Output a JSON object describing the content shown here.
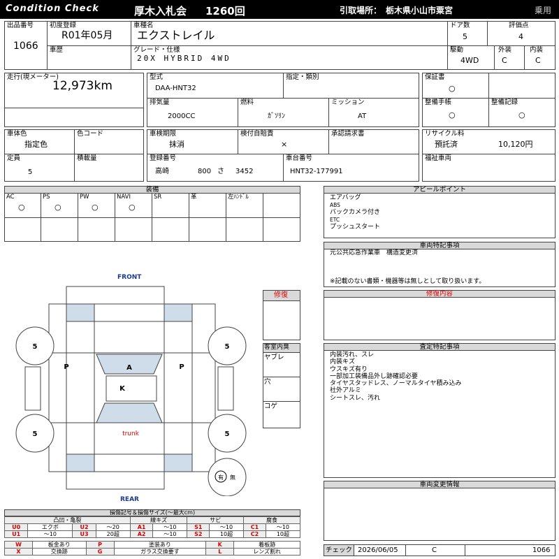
{
  "header": {
    "brand": "Condition Check",
    "auction": "厚木入札会",
    "session": "1260回",
    "pickup_label": "引取場所：",
    "pickup_place": "栃木県小山市粟宮",
    "category": "乗用"
  },
  "vehicle": {
    "lot_label": "出品番号",
    "lot": "1066",
    "first_reg_label": "初度登録",
    "first_reg": "R01年05月",
    "name_label": "車種名",
    "name": "エクストレイル",
    "doors_label": "ドア数",
    "doors": "5",
    "grade_score_label": "評価点",
    "grade_score": "4",
    "history_label": "車歴",
    "grade_label": "グレード・仕様",
    "grade": "20X HYBRID 4WD",
    "drive_label": "駆動",
    "drive": "4WD",
    "exterior_label": "外装",
    "exterior": "C",
    "interior_label": "内装",
    "interior": "C",
    "mileage_label": "走行(現メーター)",
    "mileage": "12,973km",
    "model_label": "型式",
    "model": "DAA-HNT32",
    "designation_label": "指定・類別",
    "warranty_label": "保証書",
    "warranty": "○",
    "displacement_label": "排気量",
    "displacement": "2000CC",
    "fuel_label": "燃料",
    "fuel": "ｶﾞｿﾘﾝ",
    "mission_label": "ミッション",
    "mission": "AT",
    "service_book_label": "整備手帳",
    "service_book": "○",
    "service_record_label": "整備記録",
    "service_record": "○",
    "color_label": "車体色",
    "color": "指定色",
    "color_code_label": "色コード",
    "inspection_label": "車検期限",
    "inspection": "抹消",
    "insurance_label": "検付自賠責",
    "insurance": "×",
    "approval_label": "承認請求書",
    "recycle_label": "リサイクル料",
    "recycle_status": "預託済",
    "recycle_amount": "10,120円",
    "capacity_label": "定員",
    "capacity": "5",
    "load_label": "積載量",
    "plate_label": "登録番号",
    "plate_region": "高崎",
    "plate_class": "800",
    "plate_kana": "さ",
    "plate_number": "3452",
    "chassis_label": "車台番号",
    "chassis": "HNT32-177991",
    "welfare_label": "福祉車両"
  },
  "equipment": {
    "title": "装備",
    "items": [
      {
        "name": "AC",
        "mark": "○"
      },
      {
        "name": "PS",
        "mark": "○"
      },
      {
        "name": "PW",
        "mark": "○"
      },
      {
        "name": "NAVI",
        "mark": "○"
      },
      {
        "name": "SR",
        "mark": ""
      },
      {
        "name": "革",
        "mark": ""
      },
      {
        "name": "左ﾊﾝﾄﾞﾙ",
        "mark": ""
      }
    ]
  },
  "appeal": {
    "title": "アピールポイント",
    "lines": [
      "エアバッグ",
      "ABS",
      "バックカメラ付き",
      "ETC",
      "プッシュスタート"
    ]
  },
  "special": {
    "title": "車両特記事項",
    "lines": [
      "元公共応急作業車　構造変更済"
    ],
    "note": "※記載のない書類・機器等は無しとして取り扱います。"
  },
  "repair": {
    "label": "修復",
    "title": "修復内容"
  },
  "assessment": {
    "title": "査定特記事項",
    "lines": [
      "内装汚れ、スレ",
      "内装キズ",
      "ウスキズ有り",
      "一部加工装備品外し跡確認必要",
      "タイヤスタッドレス、ノーマルタイヤ積み込み",
      "社外アルミ",
      "シートスレ、汚れ"
    ]
  },
  "change_info": {
    "title": "車両変更情報"
  },
  "cabin": {
    "title": "客室内臭",
    "items": [
      "ヤブレ",
      "穴",
      "コゲ"
    ]
  },
  "diagram": {
    "front": "FRONT",
    "rear": "REAR",
    "tire_fl": "5",
    "tire_fr": "5",
    "tire_rl": "5",
    "tire_rr": "5",
    "mark_left": "P",
    "mark_right": "P",
    "mark_windshield": "A",
    "mark_roof": "K",
    "trunk": "trunk",
    "spare_mark": "有",
    "spare_none": "無"
  },
  "legend": {
    "title": "損傷記号＆損傷サイズ(〜最大cm)",
    "head_dent": "凸凹・亀裂",
    "head_scratch": "線キズ",
    "head_rust": "サビ",
    "head_corrosion": "腐食",
    "row1": [
      {
        "code": "U0",
        "desc": "エクボ"
      },
      {
        "code": "U2",
        "desc": "〜20"
      },
      {
        "code": "A1",
        "desc": "〜10"
      },
      {
        "code": "S1",
        "desc": "〜10"
      },
      {
        "code": "C1",
        "desc": "〜10"
      }
    ],
    "row2": [
      {
        "code": "U1",
        "desc": "〜10"
      },
      {
        "code": "U3",
        "desc": "20超"
      },
      {
        "code": "A2",
        "desc": "〜10"
      },
      {
        "code": "S2",
        "desc": "10超"
      },
      {
        "code": "C2",
        "desc": "10超"
      }
    ],
    "row3": [
      {
        "code": "W",
        "desc": "板金あり"
      },
      {
        "code": "P",
        "desc": "塗装あり"
      },
      {
        "code": "K",
        "desc": "着板跡"
      }
    ],
    "row4": [
      {
        "code": "X",
        "desc": "交換跡"
      },
      {
        "code": "G",
        "desc": "ガラス交換要す"
      },
      {
        "code": "L",
        "desc": "レンズ割れ"
      }
    ]
  },
  "footer": {
    "check_label": "チェック",
    "date": "2026/06/05",
    "grade": "C",
    "lot": "1066"
  },
  "colors": {
    "header_bg": "#000000",
    "gray": "#d9d9d9",
    "blue_panel": "#cfdcea",
    "red": "#dd0000"
  }
}
